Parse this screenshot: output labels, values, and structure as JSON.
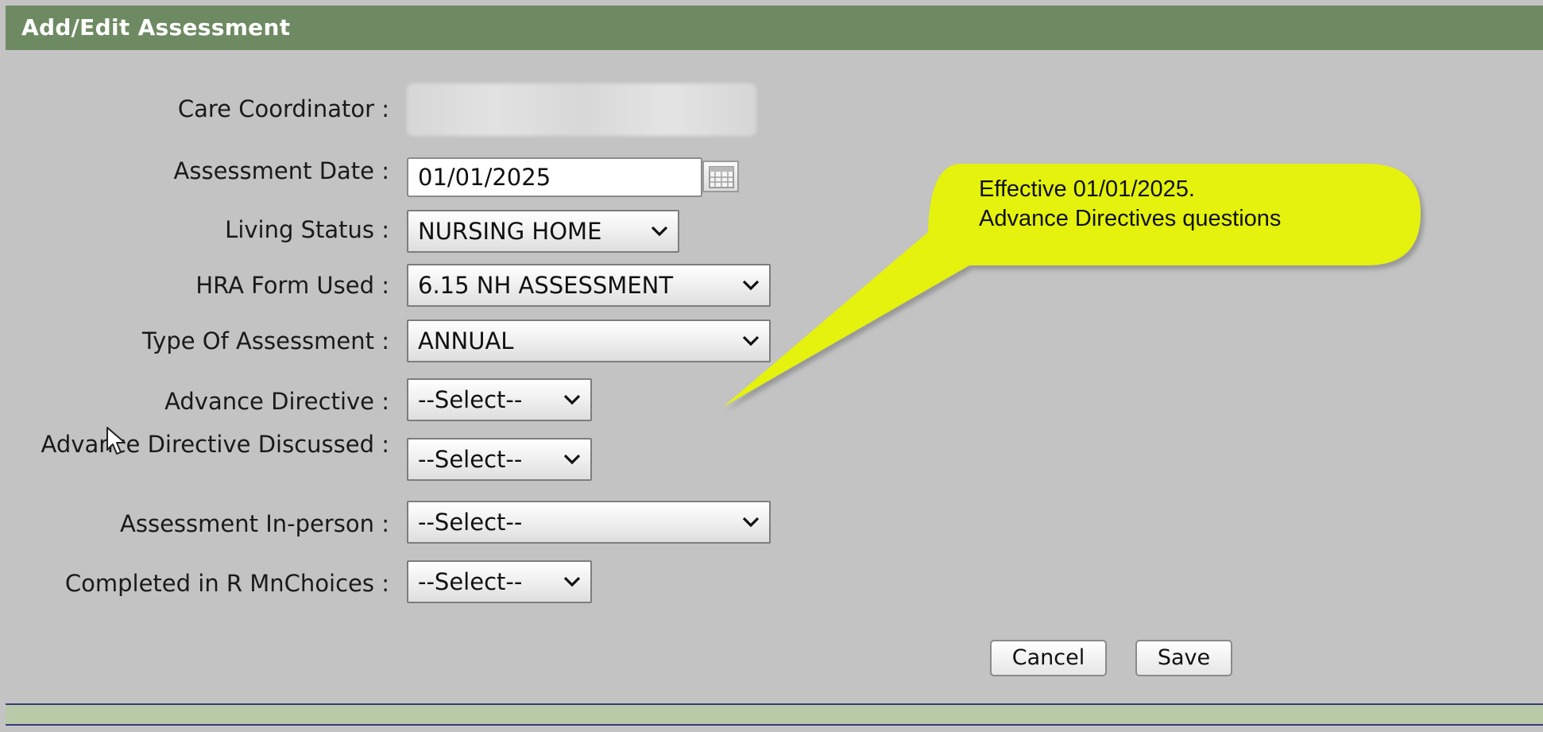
{
  "window": {
    "title": "Add/Edit Assessment"
  },
  "form": {
    "care_coordinator_label": "Care Coordinator :",
    "assessment_date_label": "Assessment Date :",
    "assessment_date_value": "01/01/2025",
    "living_status_label": "Living Status :",
    "living_status_value": "NURSING HOME",
    "hra_form_label": "HRA Form Used :",
    "hra_form_value": "6.15 NH ASSESSMENT",
    "type_label": "Type Of Assessment :",
    "type_value": "ANNUAL",
    "advance_directive_label": "Advance Directive :",
    "advance_directive_value": "--Select--",
    "advance_directive_discussed_label": "Advance Directive Discussed :",
    "advance_directive_discussed_value": "--Select--",
    "in_person_label": "Assessment In-person :",
    "in_person_value": "--Select--",
    "mnchoices_label": "Completed in R MnChoices :",
    "mnchoices_value": "--Select--"
  },
  "buttons": {
    "cancel": "Cancel",
    "save": "Save"
  },
  "callout": {
    "line1": "Effective 01/01/2025.",
    "line2": "Advance Directives questions",
    "color": "#e4f20a"
  },
  "icons": {
    "calendar": "calendar-icon",
    "chevron": "chevron-down-icon",
    "cursor": "mouse-pointer-icon"
  },
  "colors": {
    "title_bar": "#6e8a62",
    "panel": "#c3c3c3",
    "footer_bar": "#b8caa8"
  }
}
